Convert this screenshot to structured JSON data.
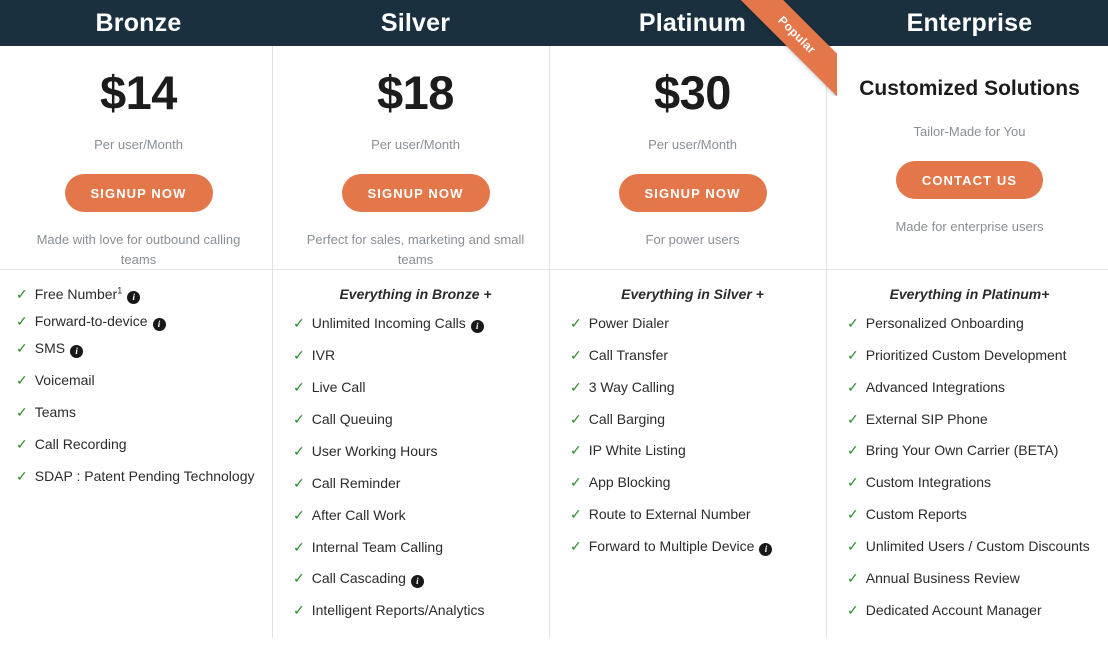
{
  "plans": [
    {
      "name": "Bronze",
      "price": "$14",
      "period": "Per user/Month",
      "cta_label": "SIGNUP NOW",
      "tagline": "Made with love for outbound calling teams",
      "popular_badge": "",
      "features_intro": "",
      "features": [
        {
          "label": "Free Number",
          "superscript": "1",
          "info": "i"
        },
        {
          "label": "Forward-to-device",
          "superscript": "",
          "info": "i"
        },
        {
          "label": "SMS",
          "superscript": "",
          "info": "i"
        },
        {
          "label": "Voicemail",
          "superscript": "",
          "info": ""
        },
        {
          "label": "Teams",
          "superscript": "",
          "info": ""
        },
        {
          "label": "Call Recording",
          "superscript": "",
          "info": ""
        },
        {
          "label": "SDAP : Patent Pending Technology",
          "superscript": "",
          "info": ""
        }
      ]
    },
    {
      "name": "Silver",
      "price": "$18",
      "period": "Per user/Month",
      "cta_label": "SIGNUP NOW",
      "tagline": "Perfect for sales, marketing and small teams",
      "popular_badge": "",
      "features_intro": "Everything in Bronze +",
      "features": [
        {
          "label": "Unlimited Incoming Calls",
          "superscript": "",
          "info": "i"
        },
        {
          "label": "IVR",
          "superscript": "",
          "info": ""
        },
        {
          "label": "Live Call",
          "superscript": "",
          "info": ""
        },
        {
          "label": "Call Queuing",
          "superscript": "",
          "info": ""
        },
        {
          "label": "User Working Hours",
          "superscript": "",
          "info": ""
        },
        {
          "label": "Call Reminder",
          "superscript": "",
          "info": ""
        },
        {
          "label": "After Call Work",
          "superscript": "",
          "info": ""
        },
        {
          "label": "Internal Team Calling",
          "superscript": "",
          "info": ""
        },
        {
          "label": "Call Cascading",
          "superscript": "",
          "info": "i"
        },
        {
          "label": "Intelligent Reports/Analytics",
          "superscript": "",
          "info": ""
        }
      ]
    },
    {
      "name": "Platinum",
      "price": "$30",
      "period": "Per user/Month",
      "cta_label": "SIGNUP NOW",
      "tagline": "For power users",
      "popular_badge": "Popular",
      "features_intro": "Everything in Silver +",
      "features": [
        {
          "label": "Power Dialer",
          "superscript": "",
          "info": ""
        },
        {
          "label": "Call Transfer",
          "superscript": "",
          "info": ""
        },
        {
          "label": "3 Way Calling",
          "superscript": "",
          "info": ""
        },
        {
          "label": "Call Barging",
          "superscript": "",
          "info": ""
        },
        {
          "label": "IP White Listing",
          "superscript": "",
          "info": ""
        },
        {
          "label": "App Blocking",
          "superscript": "",
          "info": ""
        },
        {
          "label": "Route to External Number",
          "superscript": "",
          "info": ""
        },
        {
          "label": "Forward to Multiple Device",
          "superscript": "",
          "info": "i"
        }
      ]
    },
    {
      "name": "Enterprise",
      "price": "Customized Solutions",
      "period": "Tailor-Made for You",
      "cta_label": "CONTACT US",
      "tagline": "Made for enterprise users",
      "popular_badge": "",
      "features_intro": "Everything in Platinum+",
      "features": [
        {
          "label": "Personalized Onboarding",
          "superscript": "",
          "info": ""
        },
        {
          "label": "Prioritized Custom Development",
          "superscript": "",
          "info": ""
        },
        {
          "label": "Advanced Integrations",
          "superscript": "",
          "info": ""
        },
        {
          "label": "External SIP Phone",
          "superscript": "",
          "info": ""
        },
        {
          "label": "Bring Your Own Carrier (BETA)",
          "superscript": "",
          "info": ""
        },
        {
          "label": "Custom Integrations",
          "superscript": "",
          "info": ""
        },
        {
          "label": "Custom Reports",
          "superscript": "",
          "info": ""
        },
        {
          "label": "Unlimited Users / Custom Discounts",
          "superscript": "",
          "info": ""
        },
        {
          "label": "Annual Business Review",
          "superscript": "",
          "info": ""
        },
        {
          "label": "Dedicated Account Manager",
          "superscript": "",
          "info": ""
        }
      ]
    }
  ],
  "colors": {
    "header_bg": "#1b303e",
    "accent": "#e3774a",
    "check": "#2e8b2e",
    "muted_text": "#8a8f94"
  }
}
